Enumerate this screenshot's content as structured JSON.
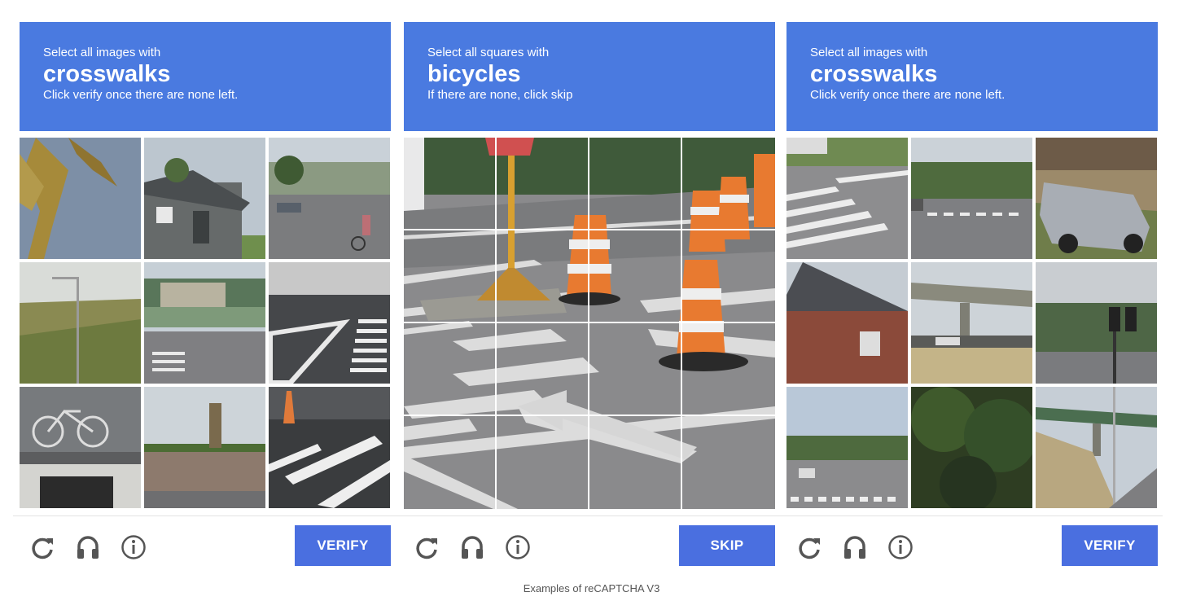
{
  "panels": [
    {
      "line1": "Select all images with",
      "object": "crosswalks",
      "line3": "Click verify once there are none left.",
      "button": "VERIFY",
      "tiles": [
        "palm-frond",
        "grey-house",
        "street-cyclist",
        "hillside-streetlight",
        "fenced-house-crosswalk",
        "crosswalk-intersection",
        "bicycle-on-wall",
        "hill-sign",
        "crosswalk-cone"
      ]
    },
    {
      "line1": "Select all squares with",
      "object": "bicycles",
      "line3": "If there are none, click skip",
      "button": "SKIP",
      "tiles": [
        "street-scene-with-cones"
      ]
    },
    {
      "line1": "Select all images with",
      "object": "crosswalks",
      "line3": "Click verify once there are none left.",
      "button": "VERIFY",
      "tiles": [
        "corner-crosswalk",
        "street-crosswalk",
        "silver-minivan",
        "brick-house",
        "overpass-field",
        "traffic-light-street",
        "road-crosswalk-town",
        "dark-trees",
        "overpass-dry-grass"
      ]
    }
  ],
  "icons": [
    "reload-icon",
    "audio-headphones-icon",
    "info-icon"
  ],
  "caption": "Examples of reCAPTCHA V3",
  "colors": {
    "header": "#4a7ae0",
    "button": "#4a6fe0",
    "icon": "#555555"
  }
}
